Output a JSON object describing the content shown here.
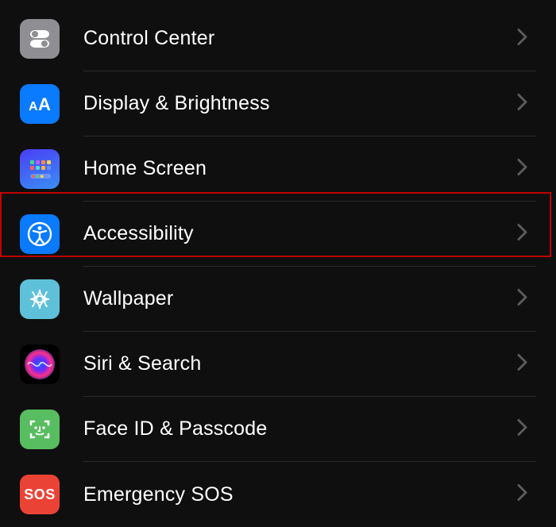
{
  "settings": {
    "items": [
      {
        "id": "control-center",
        "label": "Control Center"
      },
      {
        "id": "display-brightness",
        "label": "Display & Brightness"
      },
      {
        "id": "home-screen",
        "label": "Home Screen"
      },
      {
        "id": "accessibility",
        "label": "Accessibility"
      },
      {
        "id": "wallpaper",
        "label": "Wallpaper"
      },
      {
        "id": "siri-search",
        "label": "Siri & Search"
      },
      {
        "id": "face-id-passcode",
        "label": "Face ID & Passcode"
      },
      {
        "id": "emergency-sos",
        "label": "Emergency SOS"
      }
    ],
    "highlighted_index": 3
  },
  "colors": {
    "grey": "#8e8e93",
    "blue": "#0a7aff",
    "teal": "#5fc1d9",
    "green": "#58bd60",
    "red": "#ea4335",
    "chevron": "#5b5b5f",
    "highlight_border": "#c20000"
  },
  "sos_text": "SOS"
}
